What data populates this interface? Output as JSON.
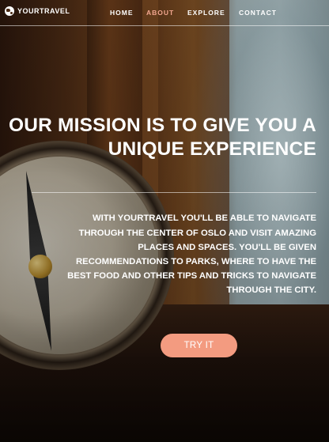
{
  "brand": {
    "name": "YOURTRAVEL",
    "icon": "globe-icon"
  },
  "nav": {
    "items": [
      {
        "label": "HOME",
        "active": false
      },
      {
        "label": "ABOUT",
        "active": true
      },
      {
        "label": "EXPLORE",
        "active": false
      },
      {
        "label": "CONTACT",
        "active": false
      }
    ],
    "active_color": "#f2a68f"
  },
  "hero": {
    "title_line1": "OUR MISSION IS TO GIVE YOU A",
    "title_line2": "UNIQUE EXPERIENCE",
    "body": {
      "prefix": "WITH ",
      "brand": "YOURTRAVEL",
      "line1_rest": " YOU'LL BE ABLE TO NAVIGATE",
      "line2": "THROUGH THE CENTER OF OSLO AND VISIT AMAZING",
      "line3": "PLACES AND SPACES. YOU'LL BE GIVEN",
      "line4": "RECOMMENDATIONS TO PARKS, WHERE TO HAVE THE",
      "line5": "BEST FOOD AND OTHER TIPS AND TRICKS TO NAVIGATE",
      "line6": "THROUGH THE CITY."
    },
    "cta_label": "TRY IT",
    "cta_color": "#f39b80"
  }
}
